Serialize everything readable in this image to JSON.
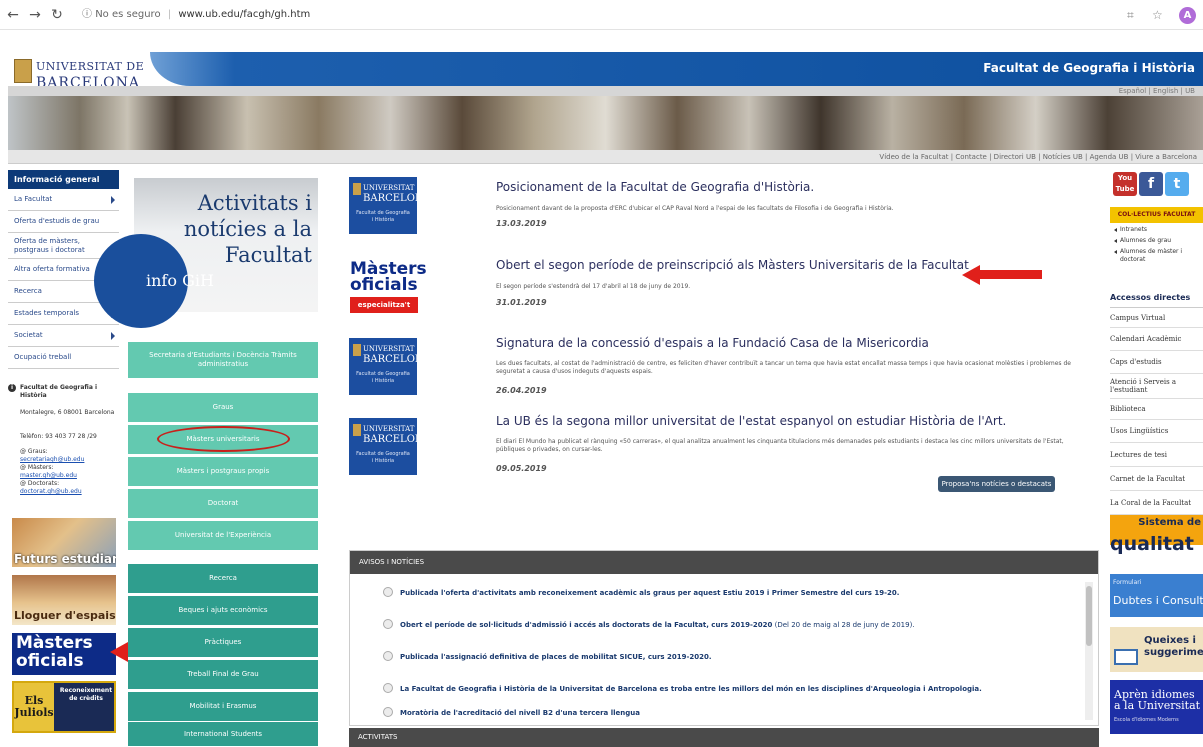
{
  "browser": {
    "security": "No es seguro",
    "url": "www.ub.edu/facgh/gh.htm",
    "avatar": "A"
  },
  "header": {
    "logo_line1": "UNIVERSITAT DE",
    "logo_line2": "BARCELONA",
    "faculty": "Facultat de Geografia i Història",
    "languages": "Español | English | UB",
    "top_links": "Vídeo de la Facultat | Contacte | Directori UB | Notícies UB | Agenda UB | Viure a Barcelona"
  },
  "left_nav": {
    "heading": "Informació general",
    "items": [
      {
        "label": "La Facultat",
        "arrow": true
      },
      {
        "label": "Oferta d'estudis de grau",
        "arrow": false
      },
      {
        "label": "Oferta de màsters, postgraus i doctorat",
        "arrow": false
      },
      {
        "label": "Altra oferta formativa",
        "arrow": false
      },
      {
        "label": "Recerca",
        "arrow": false
      },
      {
        "label": "Estades temporals",
        "arrow": true
      },
      {
        "label": "Societat",
        "arrow": true
      },
      {
        "label": "Ocupació treball",
        "arrow": false
      }
    ]
  },
  "contact": {
    "name": "Facultat de Geografia i Història",
    "address": "Montalegre, 6 08001 Barcelona",
    "phone": "Telèfon: 93 403 77 28 /29",
    "label_graus": "@ Graus:",
    "mail_graus": "secretariagh@ub.edu",
    "label_masters": "@ Màsters:",
    "mail_masters": "master.gh@ub.edu",
    "label_doctorats": "@ Doctorats:",
    "mail_doctorats": "doctorat.gh@ub.edu"
  },
  "left_banners": {
    "futurs": "Futurs estudiants",
    "lloguer": "Lloguer d'espais",
    "masters_line1": "Màsters",
    "masters_line2": "oficials",
    "juliols_left": "Els Juliols",
    "juliols_right": "Reconeixement de crèdits"
  },
  "activitats": {
    "title": "Activitats i notícies a la Facultat",
    "info": "info GiH"
  },
  "menu": [
    {
      "label": "Secretaria d'Estudiants i Docència Tràmits administratius"
    },
    {
      "label": "Graus"
    },
    {
      "label": "Màsters universitaris"
    },
    {
      "label": "Màsters i postgraus propis"
    },
    {
      "label": "Doctorat"
    },
    {
      "label": "Universitat de l'Experiència"
    },
    {
      "label": "Recerca"
    },
    {
      "label": "Beques i ajuts econòmics"
    },
    {
      "label": "Pràctiques"
    },
    {
      "label": "Treball Final de Grau"
    },
    {
      "label": "Mobilitat i Erasmus"
    },
    {
      "label": "International Students"
    }
  ],
  "thumb": {
    "ub_line1": "UNIVERSITAT DE",
    "ub_line2": "BARCELONA",
    "ub_sub": "Facultat de Geografia i Història",
    "masters_line1": "Màsters",
    "masters_line2": "oficials",
    "masters_tag": "especialitza't"
  },
  "news": [
    {
      "title": "Posicionament de la Facultat de Geografia d'Història.",
      "summary": "Posicionament davant de la proposta d'ERC d'ubicar el CAP Raval Nord a l'espai de les facultats de Filosofia i de Geografia i Història.",
      "date": "13.03.2019"
    },
    {
      "title": "Obert el segon període de preinscripció als Màsters Universitaris de la Facultat",
      "summary": "El segon període s'estendrà del 17 d'abril al 18 de juny de 2019.",
      "date": "31.01.2019"
    },
    {
      "title": "Signatura de la concessió d'espais a la Fundació Casa de la Misericordia",
      "summary": "Les dues facultats, al costat de l'administració de centre, es feliciten d'haver contribuït a tancar un tema que havia estat encallat massa temps i que havia ocasionat molèsties i problemes de seguretat a causa d'usos indeguts d'aquests espais.",
      "date": "26.04.2019"
    },
    {
      "title": "La UB és la segona millor universitat de l'estat espanyol on estudiar Història de l'Art.",
      "summary": "El diari El Mundo ha publicat el rànquing «50 carreras», el qual analitza anualment les cinquanta titulacions més demanades pels estudiants i destaca les cinc millors universitats de l'Estat, públiques o privades, on cursar-les.",
      "date": "09.05.2019"
    }
  ],
  "propose": "Proposa'ns notícies o destacats",
  "avisos": {
    "heading": "AVISOS I NOTÍCIES",
    "items": [
      {
        "bold": "Publicada l'oferta d'activitats amb reconeixement acadèmic als graus per aquest Estiu 2019 i Primer Semestre del curs 19-20.",
        "normal": ""
      },
      {
        "bold": "Obert el període de sol·licituds d'admissió i accés als doctorats de la Facultat, curs 2019-2020",
        "normal": " (Del 20 de maig al 28 de juny de 2019)."
      },
      {
        "bold": "Publicada l'assignació definitiva de places de mobilitat SICUE, curs 2019-2020.",
        "normal": ""
      },
      {
        "bold": "La Facultat de Geografia i Història de la Universitat de Barcelona es troba entre les millors del món en les disciplines d'Arqueologia i Antropologia.",
        "normal": ""
      },
      {
        "bold": "Moratòria de l'acreditació del nivell B2 d'una tercera llengua",
        "normal": ""
      }
    ]
  },
  "activitats_bar": "ACTIVITATS",
  "social": {
    "youtube": "You Tube",
    "facebook": "f",
    "twitter": "t"
  },
  "col": {
    "heading": "COL·LECTIUS FACULTAT",
    "items": [
      "Intranets",
      "Alumnes de grau",
      "Alumnes de màster i doctorat"
    ]
  },
  "accessos": {
    "heading": "Accessos directes",
    "items": [
      "Campus Virtual",
      "Calendari Acadèmic",
      "Caps d'estudis",
      "Atenció i Serveis a l'estudiant",
      "Biblioteca",
      "Usos Lingüístics",
      "Lectures de tesi",
      "Carnet de la Facultat",
      "La Coral de la Facultat"
    ]
  },
  "banners_right": {
    "qualitat_top": "Sistema de",
    "qualitat": "qualitat",
    "formulari": "Formulari",
    "dubtes": "Dubtes i Consultes",
    "queixes": "Queixes i suggeriments",
    "apren": "Aprèn idiomes a la Universitat",
    "apren_sub": "Escola d'Idiomes Moderns"
  },
  "colors": {
    "ub_blue": "#0d4f9e",
    "teal_light": "#63c9b0",
    "teal_dark": "#2f9e8e",
    "arrow_red": "#e0201b"
  },
  "icons": [
    "back-arrow-icon",
    "forward-arrow-icon",
    "reload-icon",
    "info-icon",
    "translate-icon",
    "star-icon"
  ]
}
